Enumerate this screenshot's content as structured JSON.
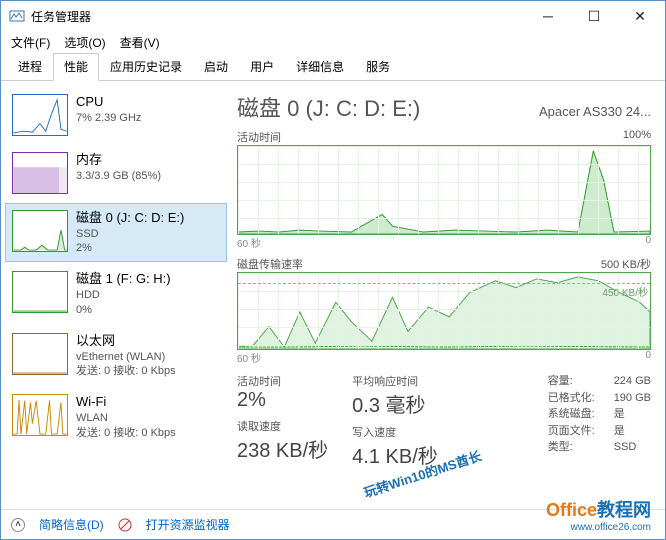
{
  "window": {
    "title": "任务管理器"
  },
  "menu": {
    "file": "文件(F)",
    "options": "选项(O)",
    "view": "查看(V)"
  },
  "tabs": [
    "进程",
    "性能",
    "应用历史记录",
    "启动",
    "用户",
    "详细信息",
    "服务"
  ],
  "active_tab": 1,
  "sidebar": [
    {
      "title": "CPU",
      "sub": "7% 2.39 GHz",
      "color": "blue"
    },
    {
      "title": "内存",
      "sub": "3.3/3.9 GB (85%)",
      "color": "purple"
    },
    {
      "title": "磁盘 0 (J: C: D: E:)",
      "sub": "SSD",
      "sub2": "2%",
      "color": "green",
      "selected": true
    },
    {
      "title": "磁盘 1 (F: G: H:)",
      "sub": "HDD",
      "sub2": "0%",
      "color": "green"
    },
    {
      "title": "以太网",
      "sub": "vEthernet (WLAN)",
      "sub2": "发送: 0 接收: 0 Kbps",
      "color": "brown"
    },
    {
      "title": "Wi-Fi",
      "sub": "WLAN",
      "sub2": "发送: 0 接收: 0 Kbps",
      "color": "orange"
    }
  ],
  "main": {
    "heading": "磁盘 0 (J: C: D: E:)",
    "model": "Apacer AS330 24...",
    "chart1": {
      "label": "活动时间",
      "max": "100%",
      "xleft": "60 秒",
      "xright": "0"
    },
    "chart2": {
      "label": "磁盘传输速率",
      "max": "500 KB/秒",
      "dash": "450 KB/秒",
      "xleft": "60 秒",
      "xright": "0"
    },
    "stats": {
      "active_label": "活动时间",
      "active": "2%",
      "resp_label": "平均响应时间",
      "resp": "0.3 毫秒",
      "read_label": "读取速度",
      "read": "238 KB/秒",
      "write_label": "写入速度",
      "write": "4.1 KB/秒"
    },
    "right": {
      "cap_l": "容量:",
      "cap": "224 GB",
      "fmt_l": "已格式化:",
      "fmt": "190 GB",
      "sys_l": "系统磁盘:",
      "sys": "是",
      "page_l": "页面文件:",
      "page": "是",
      "type_l": "类型:",
      "type": "SSD"
    }
  },
  "footer": {
    "brief": "简略信息(D)",
    "resmon": "打开资源监视器"
  },
  "watermark_diag": "玩转Win10的MS酋长",
  "watermark": "Office教程网",
  "watermark_url": "www.office26.com",
  "chart_data": [
    {
      "type": "area",
      "title": "活动时间",
      "ylim": [
        0,
        100
      ],
      "xlabel": "60 秒 → 0",
      "values": [
        2,
        3,
        2,
        4,
        3,
        2,
        3,
        5,
        2,
        3,
        4,
        20,
        8,
        3,
        2,
        3,
        2,
        4,
        3,
        2,
        3,
        2,
        3,
        4,
        3,
        2,
        3,
        2,
        95,
        60,
        3,
        2
      ]
    },
    {
      "type": "area",
      "title": "磁盘传输速率",
      "ylim": [
        0,
        500
      ],
      "xlabel": "60 秒 → 0",
      "annotation": "450 KB/秒",
      "series": [
        {
          "name": "读",
          "values": [
            10,
            5,
            120,
            30,
            10,
            200,
            20,
            140,
            260,
            150,
            40,
            280,
            60,
            180,
            30,
            220,
            200,
            150,
            350,
            120,
            450,
            380,
            440,
            300,
            420,
            460,
            430,
            440,
            400,
            380,
            280
          ]
        },
        {
          "name": "写",
          "values": [
            5,
            3,
            4,
            6,
            3,
            5,
            4,
            3,
            6,
            4,
            3,
            5,
            4,
            3,
            5,
            4,
            6,
            3,
            5,
            4,
            6,
            5,
            4,
            6,
            5,
            4,
            5,
            6,
            4,
            5,
            4
          ]
        }
      ]
    }
  ]
}
